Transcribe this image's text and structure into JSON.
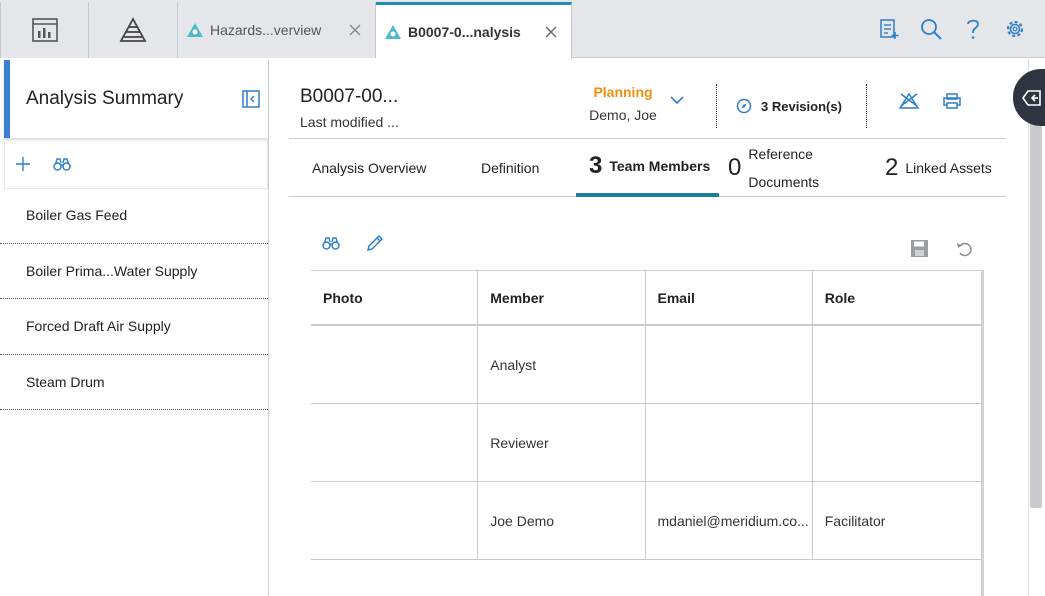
{
  "top_tabs": {
    "home_icon": "dashboard-icon",
    "hazards_icon": "hazards-icon",
    "tabs": [
      {
        "label": "Hazards...verview",
        "active": false
      },
      {
        "label": "B0007-0...nalysis",
        "active": true
      }
    ],
    "right_icons": [
      "checklist-add-icon",
      "search-icon",
      "help-icon",
      "gear-icon"
    ]
  },
  "left_panel": {
    "title": "Analysis Summary",
    "items": [
      {
        "label": "Boiler Gas Feed"
      },
      {
        "label": "Boiler Prima...Water Supply"
      },
      {
        "label": "Forced Draft Air Supply"
      },
      {
        "label": "Steam Drum"
      }
    ]
  },
  "header": {
    "title": "B0007-00...",
    "subtitle": "Last modified ...",
    "state": "Planning",
    "state_user": "Demo, Joe",
    "revisions": "3 Revision(s)"
  },
  "subtabs": [
    {
      "label": "Analysis Overview"
    },
    {
      "label": "Definition"
    },
    {
      "count": "3",
      "label": "Team Members",
      "active": true
    },
    {
      "count": "0",
      "label_line1": "Reference",
      "label_line2": "Documents"
    },
    {
      "count": "2",
      "label": "Linked Assets"
    }
  ],
  "grid": {
    "columns": [
      "Photo",
      "Member",
      "Email",
      "Role"
    ],
    "rows": [
      [
        "",
        "Analyst",
        "",
        ""
      ],
      [
        "",
        "Reviewer",
        "",
        ""
      ],
      [
        "",
        "Joe Demo",
        "mdaniel@meridium.co...",
        "Facilitator"
      ]
    ]
  },
  "colors": {
    "accent": "#1f8db3",
    "state_orange": "#f0900f",
    "icon_blue": "#2f7fc8",
    "left_accent": "#3b7fd3"
  }
}
